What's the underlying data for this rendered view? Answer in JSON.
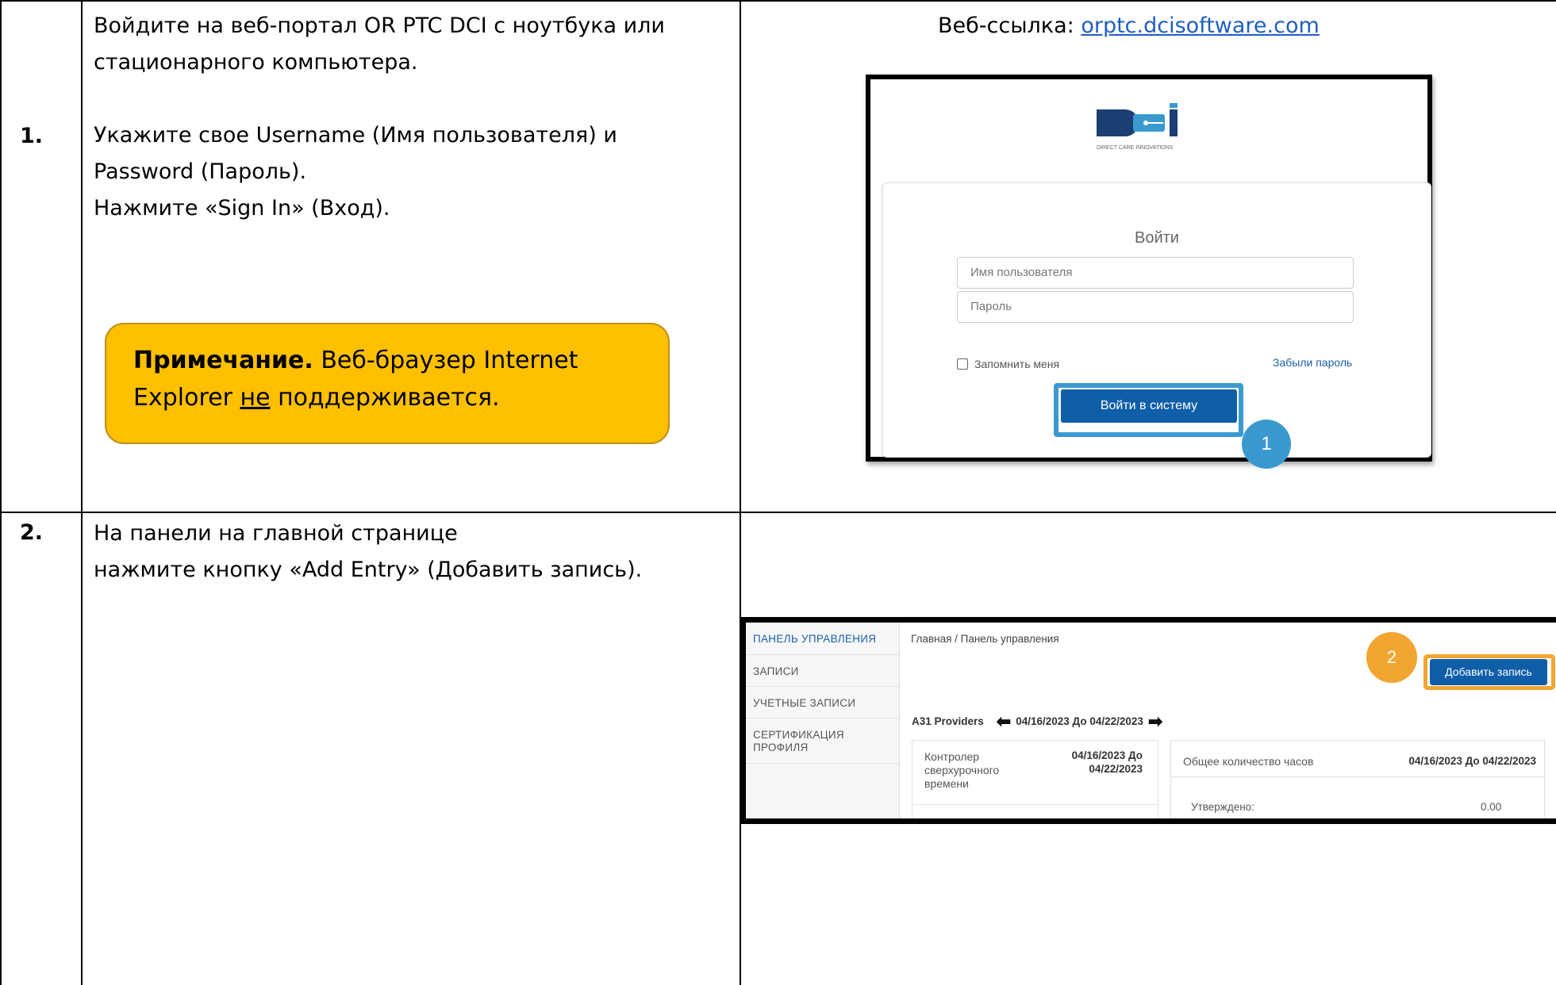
{
  "row1": {
    "number": "1.",
    "instruction_line1": "Войдите на веб-портал OR PTC DCI с ноутбука или",
    "instruction_line2": "стационарного компьютера.",
    "instruction_line3": "Укажите свое Username (Имя пользователя) и",
    "instruction_line4": "Password (Пароль).",
    "instruction_line5": "Нажмите «Sign In» (Вход).",
    "note_bold": "Примечание.",
    "note_text1": " Веб-браузер Internet",
    "note_text2_pre": "Explorer ",
    "note_text2_underlined": "не",
    "note_text2_post": " поддерживается.",
    "weblink_label": "Веб-ссылка: ",
    "weblink_url": "orptc.dcisoftware.com"
  },
  "login_screenshot": {
    "logo_subtitle": "DIRECT CARE INNOVATIONS",
    "title": "Войти",
    "username_placeholder": "Имя пользователя",
    "password_placeholder": "Пароль",
    "remember_label": "Запомнить меня",
    "forgot_label": "Забыли пароль",
    "signin_button": "Войти в систему",
    "callout_number": "1",
    "callout_color": "#3a9ad0",
    "brand_color": "#0e5ea8"
  },
  "row2": {
    "number": "2.",
    "instruction_line1": "На панели на главной странице",
    "instruction_line2": "нажмите кнопку «Add Entry» (Добавить запись)."
  },
  "dashboard_screenshot": {
    "sidebar": {
      "items": [
        {
          "label": "ПАНЕЛЬ УПРАВЛЕНИЯ"
        },
        {
          "label": "ЗАПИСИ"
        },
        {
          "label": "УЧЕТНЫЕ ЗАПИСИ"
        },
        {
          "label": "СЕРТИФИКАЦИЯ"
        },
        {
          "label": "ПРОФИЛЯ"
        }
      ]
    },
    "breadcrumb": "Главная / Панель управления",
    "add_entry_button": "Добавить запись",
    "callout_number": "2",
    "callout_color": "#f2a531",
    "provider_label": "A31 Providers",
    "date_range": "04/16/2023 До 04/22/2023",
    "overtime_panel": {
      "title_line1": "Контролер",
      "title_line2": "сверхурочного",
      "title_line3": "времени",
      "date_line1": "04/16/2023 До",
      "date_line2": "04/22/2023"
    },
    "hours_panel": {
      "title": "Общее количество часов",
      "date": "04/16/2023 До 04/22/2023",
      "approved_label": "Утверждено:",
      "approved_value": "0.00"
    }
  }
}
